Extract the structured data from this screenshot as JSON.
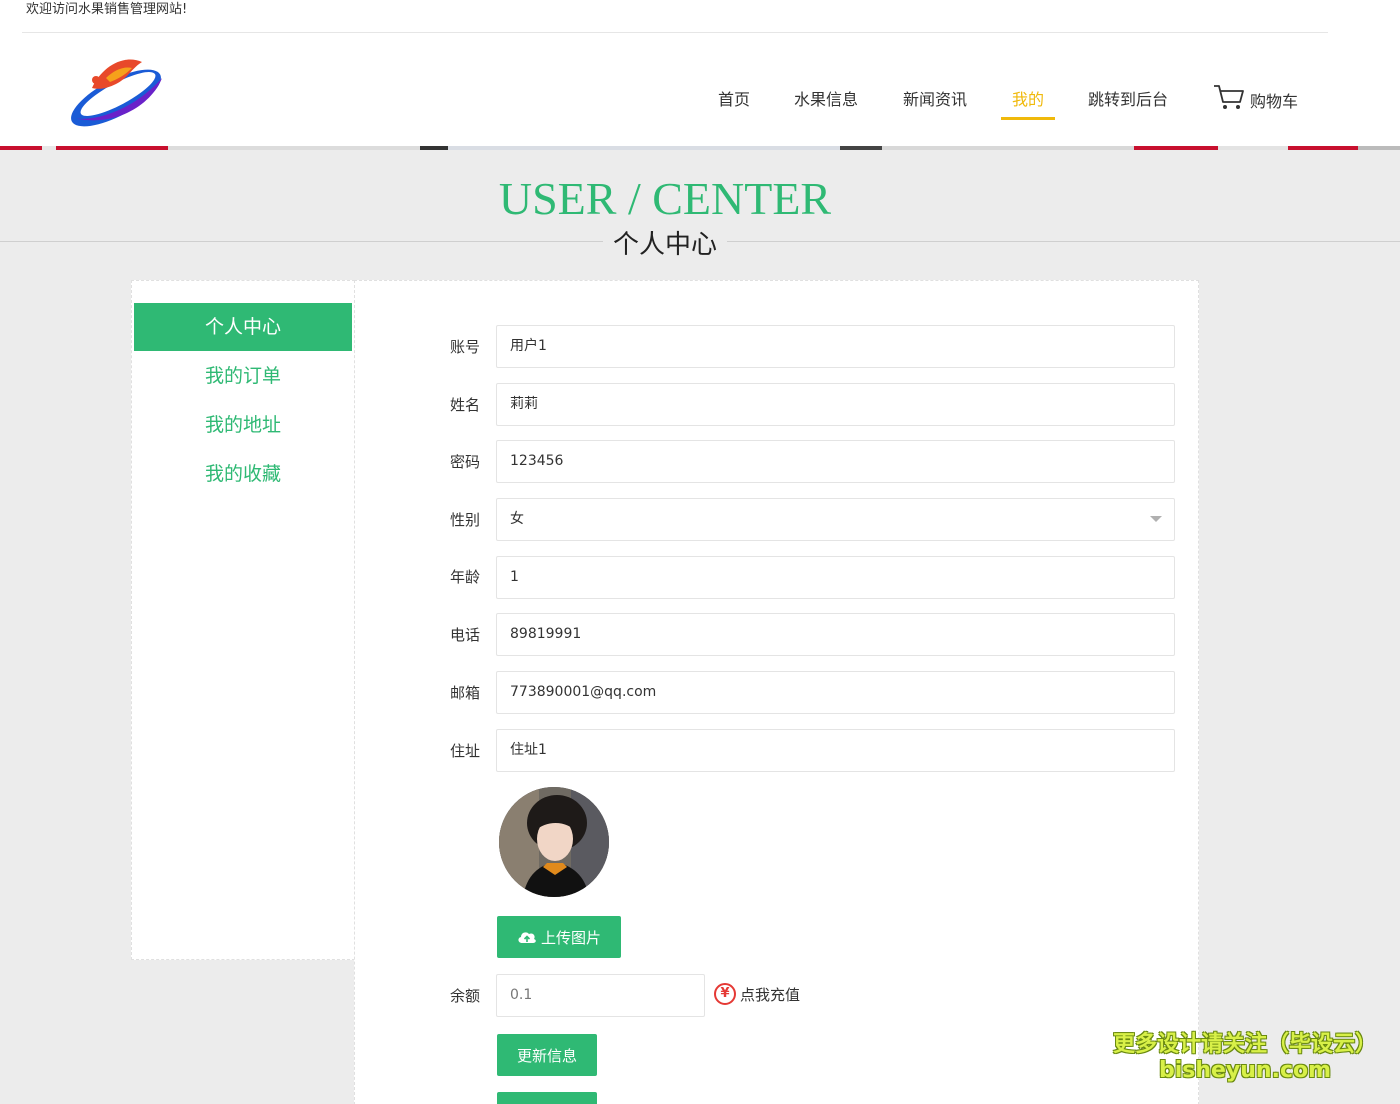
{
  "header": {
    "welcome": "欢迎访问水果销售管理网站!",
    "nav": [
      {
        "label": "首页"
      },
      {
        "label": "水果信息"
      },
      {
        "label": "新闻资讯"
      },
      {
        "label": "我的",
        "active": true
      },
      {
        "label": "跳转到后台"
      }
    ],
    "cart_label": "购物车",
    "active_color": "#f0b90b"
  },
  "title": {
    "en": "USER / CENTER",
    "cn": "个人中心"
  },
  "sidebar": {
    "items": [
      {
        "label": "个人中心",
        "active": true
      },
      {
        "label": "我的订单"
      },
      {
        "label": "我的地址"
      },
      {
        "label": "我的收藏"
      }
    ]
  },
  "form": {
    "fields": [
      {
        "label": "账号",
        "value": "用户1"
      },
      {
        "label": "姓名",
        "value": "莉莉"
      },
      {
        "label": "密码",
        "value": "123456"
      },
      {
        "label": "性别",
        "value": "女"
      },
      {
        "label": "年龄",
        "value": "1"
      },
      {
        "label": "电话",
        "value": "89819991"
      },
      {
        "label": "邮箱",
        "value": "773890001@qq.com"
      },
      {
        "label": "住址",
        "value": "住址1"
      }
    ],
    "upload_label": "上传图片",
    "balance_label": "余额",
    "balance_value": "0.1",
    "recharge_label": "点我充值",
    "update_label": "更新信息"
  },
  "watermark": {
    "line1": "更多设计请关注（毕设云）",
    "line2": "bisheyun.com"
  },
  "colors": {
    "accent": "#2fb974",
    "nav_active": "#f0b90b",
    "recharge_icon": "#e53935"
  }
}
